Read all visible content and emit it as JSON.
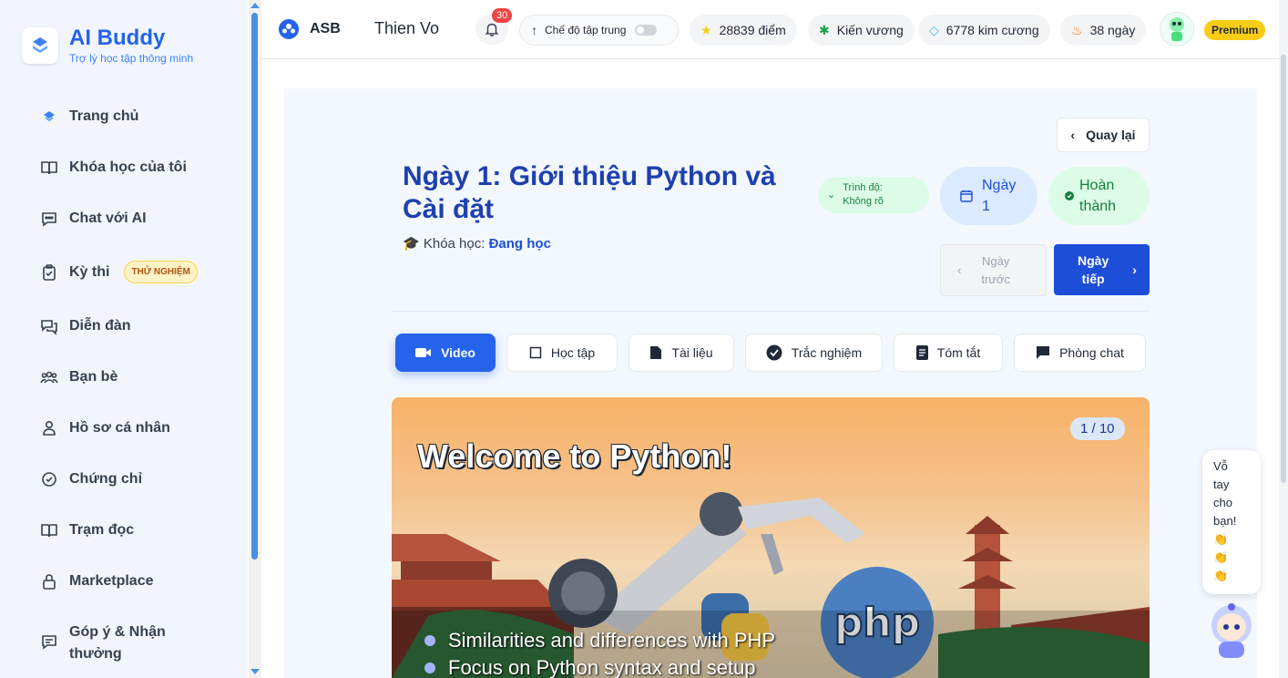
{
  "sidebar": {
    "brand_title": "AI Buddy",
    "brand_subtitle": "Trợ lý học tập thông minh",
    "items": [
      {
        "label": "Trang chủ",
        "icon": "home-logo-icon"
      },
      {
        "label": "Khóa học của tôi",
        "icon": "book-open-icon"
      },
      {
        "label": "Chat với AI",
        "icon": "chat-icon"
      },
      {
        "label": "Kỳ thi",
        "icon": "clipboard-check-icon",
        "badge": "THỬ NGHIỆM"
      },
      {
        "label": "Diễn đàn",
        "icon": "forum-icon"
      },
      {
        "label": "Bạn bè",
        "icon": "users-icon"
      },
      {
        "label": "Hồ sơ cá nhân",
        "icon": "user-icon"
      },
      {
        "label": "Chứng chỉ",
        "icon": "check-circle-icon"
      },
      {
        "label": "Trạm đọc",
        "icon": "book-open-icon"
      },
      {
        "label": "Marketplace",
        "icon": "lock-icon"
      },
      {
        "label": "Góp ý & Nhận thưởng",
        "icon": "feedback-icon"
      }
    ]
  },
  "header": {
    "brand": "ASB",
    "user_name": "Thien Vo",
    "notifications": "30",
    "focus_mode_label": "Chế độ tập trung",
    "points": "28839 điểm",
    "rank": "Kiến vương",
    "diamonds": "6778 kim cương",
    "streak": "38 ngày",
    "premium": "Premium"
  },
  "lesson": {
    "back_label": "Quay lại",
    "title": "Ngày 1: Giới thiệu Python và Cài đặt",
    "course_prefix": "Khóa học:",
    "course_status": "Đang học",
    "level_line1": "Trình độ:",
    "level_line2": "Không rõ",
    "day_line1": "Ngày",
    "day_line2": "1",
    "status_line1": "Hoàn",
    "status_line2": "thành",
    "prev_line1": "Ngày",
    "prev_line2": "trước",
    "next_line1": "Ngày",
    "next_line2": "tiếp"
  },
  "tabs": [
    {
      "label": "Video",
      "icon": "video-camera-icon",
      "active": true
    },
    {
      "label": "Học tập",
      "icon": "square-icon"
    },
    {
      "label": "Tài liệu",
      "icon": "document-icon"
    },
    {
      "label": "Trắc nghiệm",
      "icon": "check-circle-icon"
    },
    {
      "label": "Tóm tắt",
      "icon": "list-icon"
    },
    {
      "label": "Phòng chat",
      "icon": "chat-bubble-icon"
    }
  ],
  "slide": {
    "counter": "1 / 10",
    "title": "Welcome to Python!",
    "bullets": [
      "Similarities and differences with PHP",
      "Focus on Python syntax and setup"
    ],
    "php_logo_text": "php"
  },
  "cheer": {
    "text_lines": [
      "Vỗ",
      "tay",
      "cho",
      "bạn!"
    ],
    "emoji": "👏"
  },
  "colors": {
    "accent": "#2563eb",
    "sidebar_bg": "#f2f6fc",
    "success": "#15803d",
    "premium": "#facc15"
  }
}
